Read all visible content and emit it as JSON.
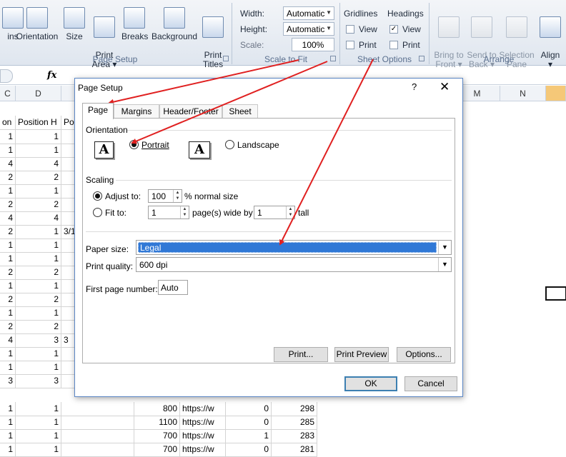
{
  "ribbon": {
    "page_setup_buttons": [
      {
        "label": "ins",
        "icon": "margins-icon"
      },
      {
        "label": "Orientation",
        "icon": "orientation-icon"
      },
      {
        "label": "Size",
        "icon": "size-icon"
      },
      {
        "label": "Print\nArea ▾",
        "icon": "print-area-icon"
      },
      {
        "label": "Breaks",
        "icon": "breaks-icon"
      },
      {
        "label": "Background",
        "icon": "background-icon"
      },
      {
        "label": "Print\nTitles",
        "icon": "print-titles-icon"
      }
    ],
    "group_page_setup": "Page Setup",
    "scale": {
      "width_label": "Width:",
      "width_value": "Automatic",
      "height_label": "Height:",
      "height_value": "Automatic",
      "scale_label": "Scale:",
      "scale_value": "100%",
      "group_label": "Scale to Fit"
    },
    "sheet_options": {
      "gridlines": "Gridlines",
      "headings": "Headings",
      "view": "View",
      "print": "Print",
      "gridlines_view": false,
      "gridlines_print": false,
      "headings_view": true,
      "headings_print": false,
      "group_label": "Sheet Options"
    },
    "arrange_buttons": [
      {
        "label": "Bring to\nFront ▾",
        "icon": "bring-to-front-icon",
        "enabled": false
      },
      {
        "label": "Send to\nBack ▾",
        "icon": "send-to-back-icon",
        "enabled": false
      },
      {
        "label": "Selection\nPane",
        "icon": "selection-pane-icon",
        "enabled": false
      },
      {
        "label": "Align\n▾",
        "icon": "align-icon",
        "enabled": true
      }
    ],
    "group_arrange": "Arrange"
  },
  "formula_bar": {
    "fx": "fx"
  },
  "sheet": {
    "columns": [
      "C",
      "D",
      "",
      "M",
      "N"
    ],
    "header_row": [
      "on",
      "Position H",
      "Po"
    ],
    "rows": [
      [
        "1",
        "1",
        ""
      ],
      [
        "1",
        "1",
        ""
      ],
      [
        "4",
        "4",
        ""
      ],
      [
        "2",
        "2",
        ""
      ],
      [
        "1",
        "1",
        ""
      ],
      [
        "2",
        "2",
        ""
      ],
      [
        "4",
        "4",
        ""
      ],
      [
        "2",
        "1",
        "3/1"
      ],
      [
        "1",
        "1",
        ""
      ],
      [
        "1",
        "1",
        ""
      ],
      [
        "2",
        "2",
        ""
      ],
      [
        "1",
        "1",
        ""
      ],
      [
        "2",
        "2",
        ""
      ],
      [
        "1",
        "1",
        ""
      ],
      [
        "2",
        "2",
        ""
      ],
      [
        "4",
        "3",
        "3"
      ],
      [
        "1",
        "1",
        ""
      ],
      [
        "1",
        "1",
        ""
      ],
      [
        "3",
        "3",
        ""
      ]
    ],
    "bottom_rows": [
      [
        "1",
        "1",
        "",
        "800",
        "https://w",
        "0",
        "298"
      ],
      [
        "1",
        "1",
        "",
        "1100",
        "https://w",
        "0",
        "285"
      ],
      [
        "1",
        "1",
        "",
        "700",
        "https://w",
        "1",
        "283"
      ],
      [
        "1",
        "1",
        "",
        "700",
        "https://w",
        "0",
        "281"
      ]
    ]
  },
  "dialog": {
    "title": "Page Setup",
    "help": "?",
    "close": "✕",
    "tabs": [
      "Page",
      "Margins",
      "Header/Footer",
      "Sheet"
    ],
    "active_tab": "Page",
    "orientation": {
      "section": "Orientation",
      "portrait": "Portrait",
      "landscape": "Landscape",
      "selected": "portrait",
      "icon_letter": "A"
    },
    "scaling": {
      "section": "Scaling",
      "adjust_to": "Adjust to:",
      "adjust_value": "100",
      "normal_size": "% normal size",
      "fit_to": "Fit to:",
      "fit_wide": "1",
      "pages_wide": "page(s) wide by",
      "fit_tall": "1",
      "tall": "tall",
      "selected": "adjust"
    },
    "paper_size_label": "Paper size:",
    "paper_size_value": "Legal",
    "print_quality_label": "Print quality:",
    "print_quality_value": "600 dpi",
    "first_page_label": "First page number:",
    "first_page_value": "Auto",
    "buttons": {
      "print": "Print...",
      "preview": "Print Preview",
      "options": "Options...",
      "ok": "OK",
      "cancel": "Cancel"
    }
  },
  "annotation_color": "#e02020"
}
